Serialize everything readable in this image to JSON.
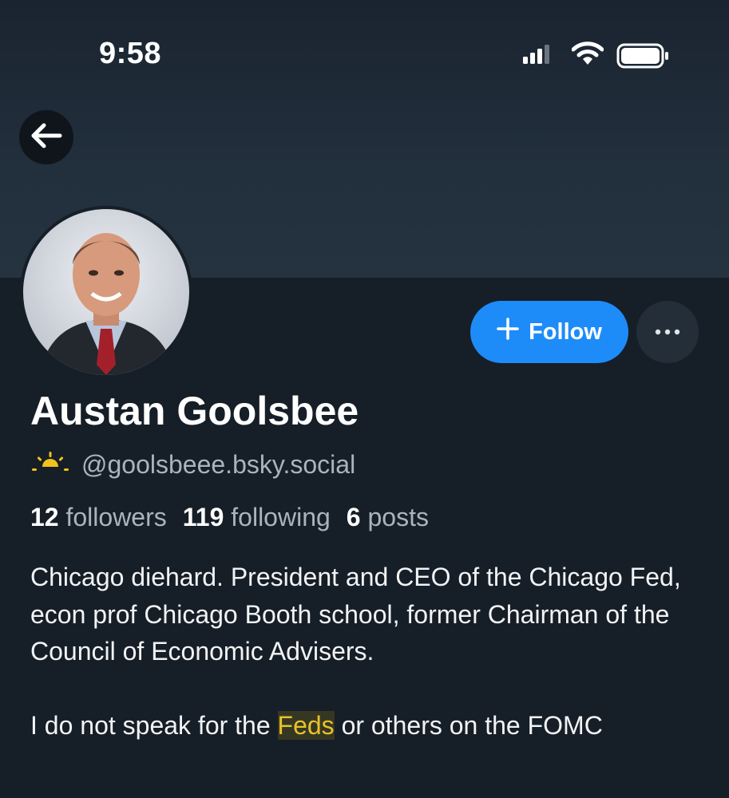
{
  "status_bar": {
    "time": "9:58"
  },
  "profile": {
    "display_name": "Austan Goolsbee",
    "handle": "@goolsbeee.bsky.social",
    "follow_label": "Follow",
    "stats": {
      "followers_count": "12",
      "followers_label": "followers",
      "following_count": "119",
      "following_label": "following",
      "posts_count": "6",
      "posts_label": "posts"
    },
    "bio": {
      "paragraph1": "Chicago diehard. President and CEO of the Chicago Fed, econ prof Chicago Booth school, former Chairman of the Council of Economic Advisers.",
      "paragraph2_before": "I do not speak for the ",
      "paragraph2_highlight": "Feds",
      "paragraph2_after": " or others on the FOMC"
    }
  },
  "icons": {
    "back": "arrow-left-icon",
    "plus": "plus-icon",
    "more": "ellipsis-icon",
    "badge": "sunrise-icon"
  },
  "colors": {
    "background": "#161e27",
    "banner": "#222f3c",
    "accent": "#1d8cf8",
    "highlight": "#e8c22a",
    "badge": "#f2c21a"
  }
}
